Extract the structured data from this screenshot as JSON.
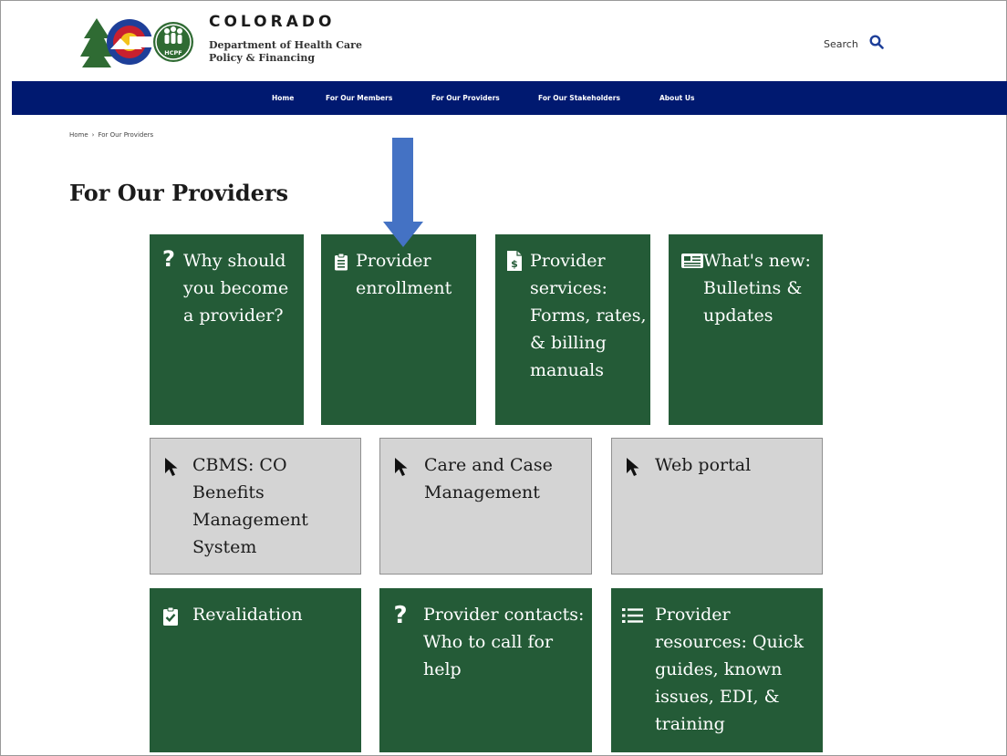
{
  "header": {
    "brand_title": "COLORADO",
    "department_line1": "Department of Health Care",
    "department_line2": "Policy & Financing",
    "logo_badge": "HCPF",
    "search_label": "Search"
  },
  "nav": {
    "items": [
      "Home",
      "For Our Members",
      "For Our Providers",
      "For Our Stakeholders",
      "About Us"
    ]
  },
  "breadcrumb": {
    "home": "Home",
    "separator": "›",
    "current": "For Our Providers"
  },
  "page": {
    "title": "For Our Providers"
  },
  "tiles": {
    "why_become": {
      "icon": "question-icon",
      "label": "Why should you become a provider?"
    },
    "enrollment": {
      "icon": "clipboard-list-icon",
      "label": "Provider enrollment"
    },
    "services": {
      "icon": "invoice-icon",
      "label": "Provider services: Forms, rates, & billing manuals"
    },
    "whats_new": {
      "icon": "newspaper-icon",
      "label": "What's new: Bulletins & updates"
    },
    "cbms": {
      "icon": "cursor-icon",
      "label": "CBMS: CO Benefits Management System"
    },
    "care_case": {
      "icon": "cursor-icon",
      "label": "Care and Case Management"
    },
    "web_portal": {
      "icon": "cursor-icon",
      "label": "Web portal"
    },
    "revalidation": {
      "icon": "clipboard-check-icon",
      "label": "Revalidation"
    },
    "contacts": {
      "icon": "question-icon",
      "label": "Provider contacts: Who to call for help"
    },
    "resources": {
      "icon": "list-icon",
      "label": "Provider resources: Quick guides, known issues, EDI, & training"
    }
  },
  "colors": {
    "nav_bg": "#001970",
    "tile_green": "#245b37",
    "tile_gray": "#d4d4d4",
    "annotation_arrow": "#4472c4",
    "search_icon": "#1e3f99"
  }
}
